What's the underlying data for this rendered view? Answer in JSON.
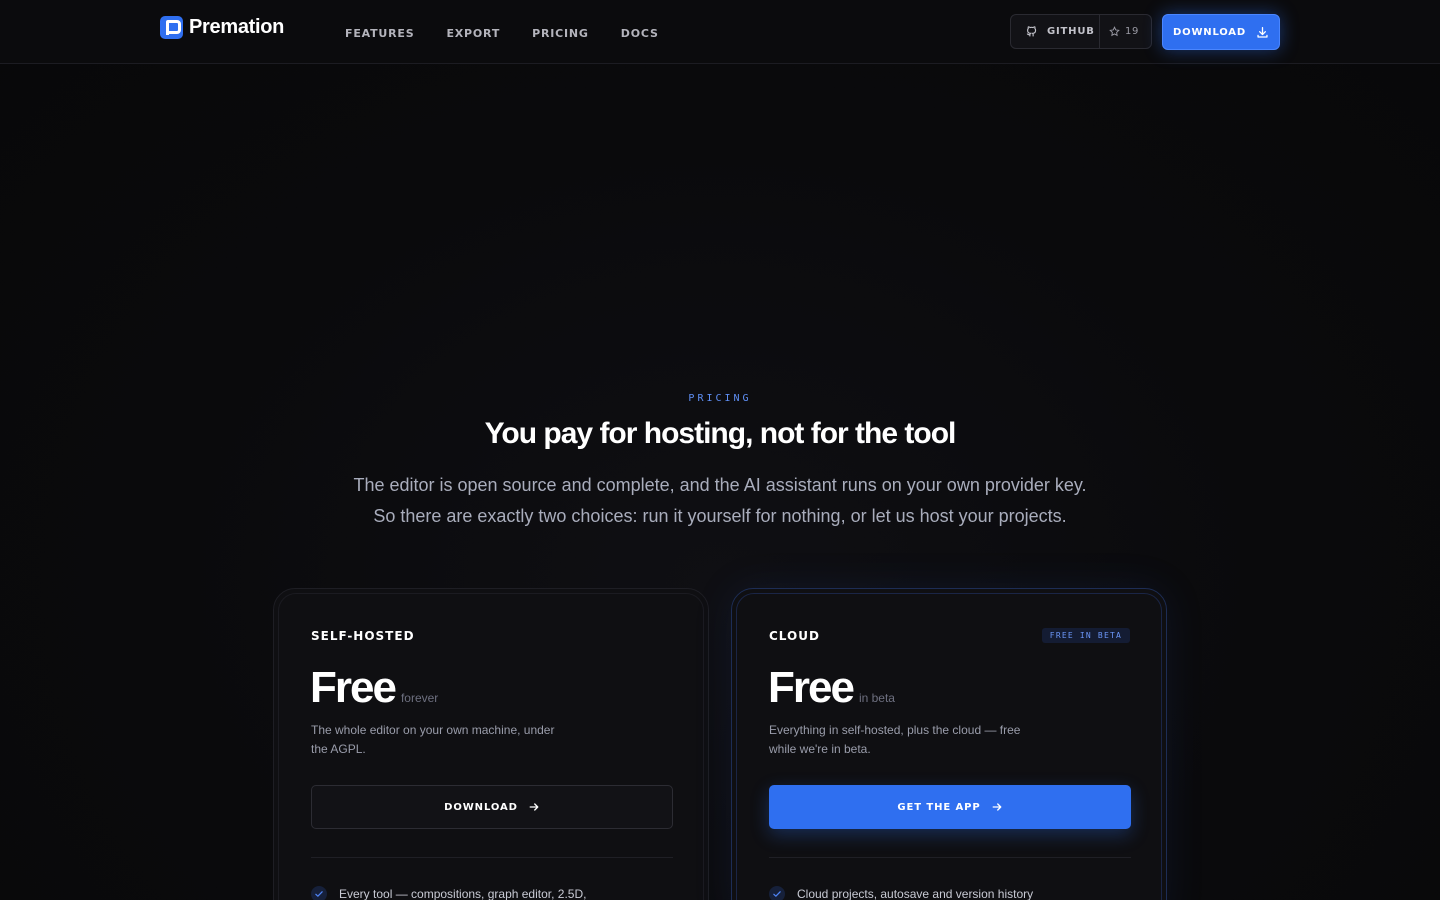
{
  "brand": {
    "name": "Premation",
    "accent": "#2f6ff0"
  },
  "nav": {
    "items": [
      "FEATURES",
      "EXPORT",
      "PRICING",
      "DOCS"
    ]
  },
  "github": {
    "label": "GITHUB",
    "stars": "19",
    "icon": "github-icon",
    "star_icon": "star-icon"
  },
  "header_download": {
    "label": "DOWNLOAD",
    "icon": "download-icon"
  },
  "hero": {
    "eyebrow": "PRICING",
    "title": "You pay for hosting, not for the tool",
    "subtitle_line1": "The editor is open source and complete, and the AI assistant runs on your own provider key.",
    "subtitle_line2": "So there are exactly two choices: run it yourself for nothing, or let us host your projects."
  },
  "plans": [
    {
      "name": "SELF-HOSTED",
      "price": "Free",
      "price_note": "forever",
      "description": "The whole editor on your own machine, under the AGPL.",
      "cta": "DOWNLOAD",
      "feature": "Every tool — compositions, graph editor, 2.5D,"
    },
    {
      "name": "CLOUD",
      "badge": "FREE IN BETA",
      "price": "Free",
      "price_note": "in beta",
      "description": "Everything in self-hosted, plus the cloud — free while we're in beta.",
      "cta": "GET THE APP",
      "feature": "Cloud projects, autosave and version history"
    }
  ]
}
